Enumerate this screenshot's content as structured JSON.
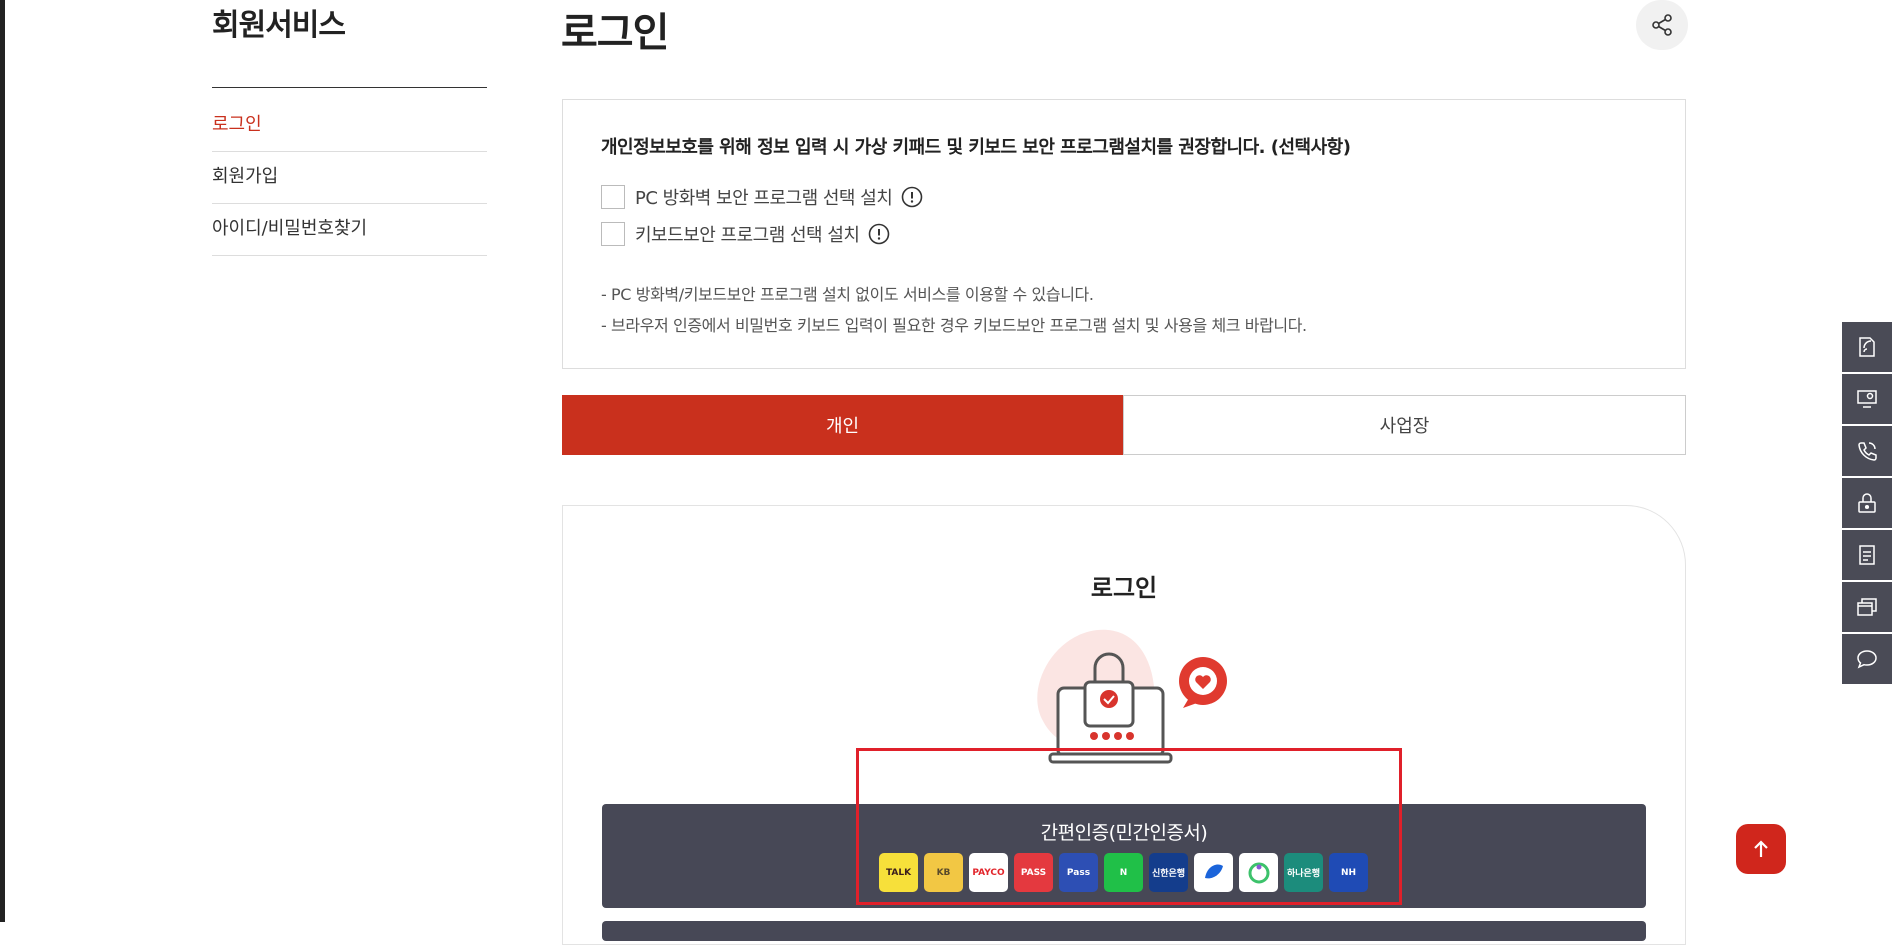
{
  "sidebar": {
    "title": "회원서비스",
    "items": [
      {
        "label": "로그인"
      },
      {
        "label": "회원가입"
      },
      {
        "label": "아이디/비밀번호찾기"
      }
    ]
  },
  "header": {
    "title": "로그인",
    "share_icon": "share-icon"
  },
  "notice": {
    "heading": "개인정보보호를 위해 정보 입력 시 가상 키패드 및 키보드 보안 프로그램설치를 권장합니다. (선택사항)",
    "options": [
      {
        "label": "PC 방화벽 보안 프로그램 선택 설치",
        "checked": false
      },
      {
        "label": "키보드보안 프로그램 선택 설치",
        "checked": false
      }
    ],
    "bullets": [
      "-  PC 방화벽/키보드보안 프로그램 설치 없이도 서비스를 이용할 수 있습니다.",
      "-  브라우저 인증에서 비밀번호 키보드 입력이 필요한 경우 키보드보안 프로그램 설치 및 사용을 체크 바랍니다."
    ]
  },
  "tabs": [
    {
      "label": "개인",
      "active": true
    },
    {
      "label": "사업장",
      "active": false
    }
  ],
  "login_card": {
    "title": "로그인",
    "easy_auth": {
      "label": "간편인증(민간인증서)",
      "providers": [
        {
          "name": "kakao",
          "text": "TALK",
          "bg": "#f7e03a",
          "fg": "#3a1d1d"
        },
        {
          "name": "kb",
          "text": "KB",
          "bg": "#f2c744",
          "fg": "#5a4a2a"
        },
        {
          "name": "payco",
          "text": "PAYCO",
          "bg": "#ffffff",
          "fg": "#e2262c"
        },
        {
          "name": "pass-red",
          "text": "PASS",
          "bg": "#e4393f",
          "fg": "#ffffff"
        },
        {
          "name": "samsung-pass",
          "text": "Pass",
          "bg": "#2d4fb4",
          "fg": "#ffffff"
        },
        {
          "name": "naver",
          "text": "N",
          "bg": "#20c048",
          "fg": "#ffffff"
        },
        {
          "name": "shinhan",
          "text": "신한은행",
          "bg": "#143d8c",
          "fg": "#ffffff"
        },
        {
          "name": "toss",
          "text": "",
          "bg": "#ffffff",
          "fg": "#1b64da"
        },
        {
          "name": "banksalad",
          "text": "",
          "bg": "#ffffff",
          "fg": "#3cc26b"
        },
        {
          "name": "hana",
          "text": "하나은행",
          "bg": "#1c8c7c",
          "fg": "#ffffff"
        },
        {
          "name": "nh",
          "text": "NH",
          "bg": "#1f4bb5",
          "fg": "#ffffff"
        }
      ]
    }
  },
  "quick_menu": [
    {
      "icon": "document-signal-icon"
    },
    {
      "icon": "monitor-person-icon"
    },
    {
      "icon": "phone-icon"
    },
    {
      "icon": "lock-icon"
    },
    {
      "icon": "document-list-icon"
    },
    {
      "icon": "windows-stack-icon"
    },
    {
      "icon": "chat-bubble-icon"
    }
  ],
  "colors": {
    "accent": "#c9301d",
    "dark_button": "#474856",
    "quick_menu": "#4a4b56",
    "highlight": "#e0202a"
  }
}
